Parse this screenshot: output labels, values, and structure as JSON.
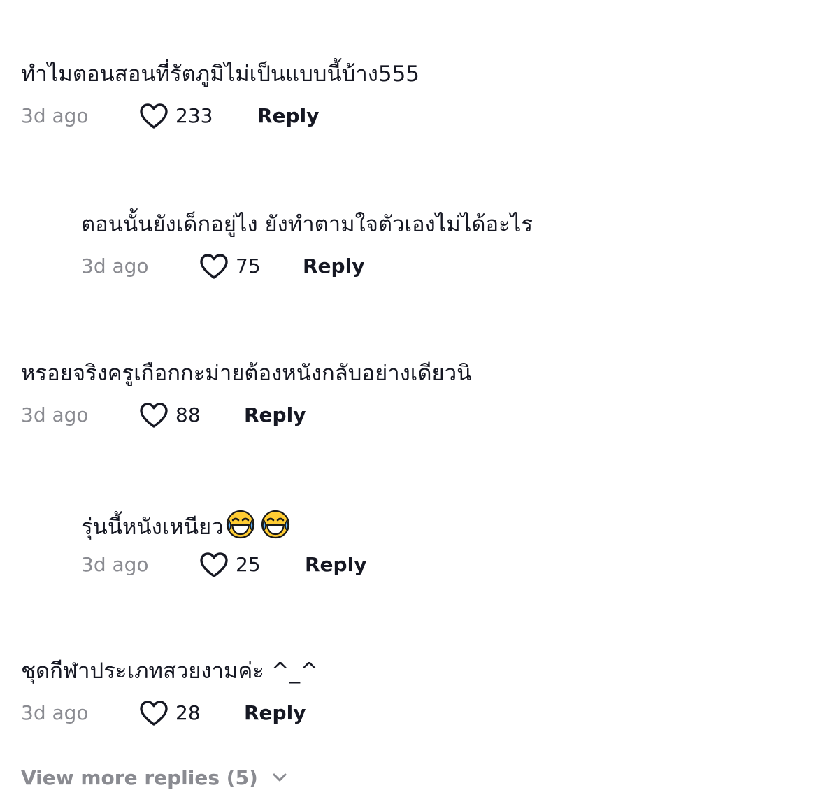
{
  "comments": [
    {
      "text": "ทำไมตอนสอนที่รัตภูมิไม่เป็นแบบนี้บ้าง555",
      "time": "3d ago",
      "likes": "233",
      "reply_label": "Reply"
    },
    {
      "text": "ตอนนั้นยังเด็กอยู่ไง ยังทำตามใจตัวเองไม่ได้อะไร",
      "time": "3d ago",
      "likes": "75",
      "reply_label": "Reply"
    },
    {
      "text": "หรอยจริงครูเกือกกะม่ายต้องหนังกลับอย่างเดียวนิ",
      "time": "3d ago",
      "likes": "88",
      "reply_label": "Reply"
    },
    {
      "text": "รุ่นนี้หนังเหนียว",
      "emojis": [
        "face-with-tears-of-joy",
        "face-with-tears-of-joy"
      ],
      "time": "3d ago",
      "likes": "25",
      "reply_label": "Reply"
    },
    {
      "text": "ชุดกีฬาประเภทสวยงามค่ะ ^_^",
      "time": "3d ago",
      "likes": "28",
      "reply_label": "Reply"
    }
  ],
  "view_more_label": "View more replies (5)",
  "icons": {
    "like": "heart-outline-icon",
    "expand": "chevron-down-icon"
  },
  "colors": {
    "text": "#161823",
    "muted": "#8a8b91",
    "emoji_face": "#ffcc33"
  }
}
